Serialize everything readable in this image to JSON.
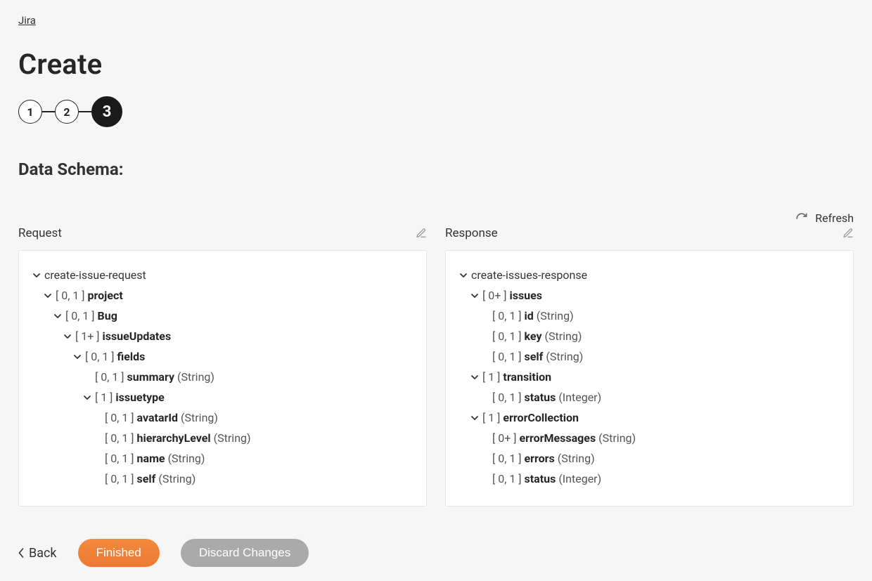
{
  "breadcrumb": "Jira",
  "title": "Create",
  "stepper": {
    "steps": [
      "1",
      "2",
      "3"
    ],
    "activeIndex": 2
  },
  "sectionTitle": "Data Schema:",
  "refreshLabel": "Refresh",
  "request": {
    "label": "Request",
    "items": [
      {
        "indent": 0,
        "chevron": true,
        "card": "",
        "name": "create-issue-request",
        "type": "",
        "nameNormal": true
      },
      {
        "indent": 1,
        "chevron": true,
        "card": "[ 0, 1 ]",
        "name": "project",
        "type": ""
      },
      {
        "indent": 2,
        "chevron": true,
        "card": "[ 0, 1 ]",
        "name": "Bug",
        "type": ""
      },
      {
        "indent": 3,
        "chevron": true,
        "card": "[ 1+ ]",
        "name": "issueUpdates",
        "type": ""
      },
      {
        "indent": 4,
        "chevron": true,
        "card": "[ 0, 1 ]",
        "name": "fields",
        "type": ""
      },
      {
        "indent": 5,
        "chevron": false,
        "card": "[ 0, 1 ]",
        "name": "summary",
        "type": "(String)"
      },
      {
        "indent": 5,
        "chevron": true,
        "card": "[ 1 ]",
        "name": "issuetype",
        "type": ""
      },
      {
        "indent": 6,
        "chevron": false,
        "card": "[ 0, 1 ]",
        "name": "avatarId",
        "type": "(String)"
      },
      {
        "indent": 6,
        "chevron": false,
        "card": "[ 0, 1 ]",
        "name": "hierarchyLevel",
        "type": "(String)"
      },
      {
        "indent": 6,
        "chevron": false,
        "card": "[ 0, 1 ]",
        "name": "name",
        "type": "(String)"
      },
      {
        "indent": 6,
        "chevron": false,
        "card": "[ 0, 1 ]",
        "name": "self",
        "type": "(String)"
      }
    ]
  },
  "response": {
    "label": "Response",
    "items": [
      {
        "indent": 0,
        "chevron": true,
        "card": "",
        "name": "create-issues-response",
        "type": "",
        "nameNormal": true
      },
      {
        "indent": 1,
        "chevron": true,
        "card": "[ 0+ ]",
        "name": "issues",
        "type": ""
      },
      {
        "indent": 2,
        "chevron": false,
        "card": "[ 0, 1 ]",
        "name": "id",
        "type": "(String)"
      },
      {
        "indent": 2,
        "chevron": false,
        "card": "[ 0, 1 ]",
        "name": "key",
        "type": "(String)"
      },
      {
        "indent": 2,
        "chevron": false,
        "card": "[ 0, 1 ]",
        "name": "self",
        "type": "(String)"
      },
      {
        "indent": 1,
        "chevron": true,
        "card": "[ 1 ]",
        "name": "transition",
        "type": ""
      },
      {
        "indent": 2,
        "chevron": false,
        "card": "[ 0, 1 ]",
        "name": "status",
        "type": "(Integer)"
      },
      {
        "indent": 1,
        "chevron": true,
        "card": "[ 1 ]",
        "name": "errorCollection",
        "type": ""
      },
      {
        "indent": 2,
        "chevron": false,
        "card": "[ 0+ ]",
        "name": "errorMessages",
        "type": "(String)"
      },
      {
        "indent": 2,
        "chevron": false,
        "card": "[ 0, 1 ]",
        "name": "errors",
        "type": "(String)"
      },
      {
        "indent": 2,
        "chevron": false,
        "card": "[ 0, 1 ]",
        "name": "status",
        "type": "(Integer)"
      }
    ]
  },
  "footer": {
    "back": "Back",
    "finished": "Finished",
    "discard": "Discard Changes"
  }
}
